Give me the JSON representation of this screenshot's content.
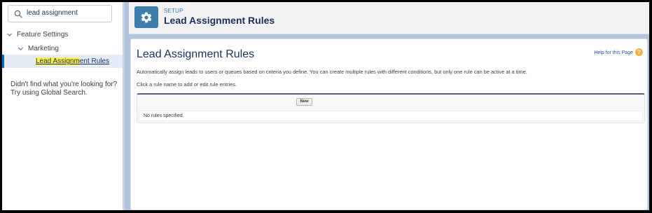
{
  "sidebar": {
    "search_value": "lead assignment",
    "tree": {
      "feature_settings": "Feature Settings",
      "marketing": "Marketing",
      "lead_rules_highlight": "Lead Assignm",
      "lead_rules_rest": "ent Rules"
    },
    "not_found_line1": "Didn't find what you're looking for?",
    "not_found_line2": "Try using Global Search."
  },
  "header": {
    "eyebrow": "SETUP",
    "title": "Lead Assignment Rules",
    "icon": "gear-icon"
  },
  "main": {
    "page_title": "Lead Assignment Rules",
    "help_link": "Help for this Page",
    "help_icon": "?",
    "description": "Automatically assign leads to users or queues based on criteria you define. You can create multiple rules with different conditions, but only one rule can be active at a time.",
    "instruction": "Click a rule name to add or edit rule entries.",
    "new_button": "New",
    "empty_message": "No rules specified."
  }
}
